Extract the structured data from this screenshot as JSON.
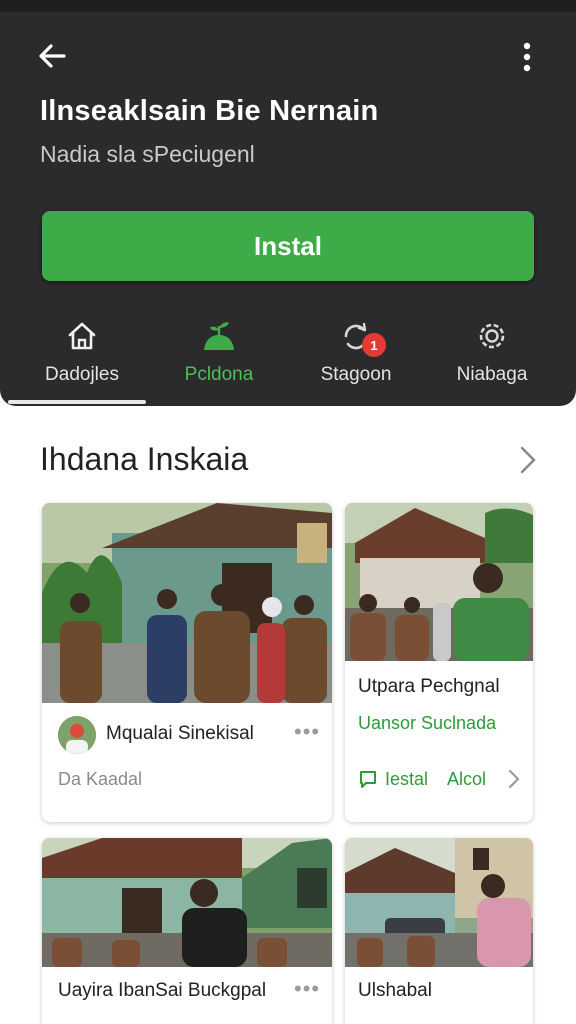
{
  "header": {
    "app_title": "Ilnseaklsain Bie Nernain",
    "app_subtitle": "Nadia sla sPeciugenl",
    "install_label": "Instal"
  },
  "tabs": [
    {
      "label": "Dadojles",
      "icon": "home-icon",
      "selected": true
    },
    {
      "label": "Pcldona",
      "icon": "plant-icon",
      "color": "#4bbf54"
    },
    {
      "label": "Stagoon",
      "icon": "sync-icon",
      "badge": "1"
    },
    {
      "label": "Niabaga",
      "icon": "settings-icon"
    }
  ],
  "section": {
    "title": "Ihdana Inskaia"
  },
  "cards": [
    {
      "title": "Mqualai Sinekisal",
      "meta": "Da Kaadal"
    },
    {
      "title": "Utpara Pechgnal",
      "subtitle": "Uansor Suclnada",
      "action_1": "Iestal",
      "action_2": "Alcol"
    },
    {
      "title": "Uayira IbanSai Buckgpal"
    },
    {
      "title": "Ulshabal"
    }
  ],
  "colors": {
    "accent_green": "#3eab48",
    "header_bg": "#2b2b2d",
    "badge_red": "#e53935"
  }
}
